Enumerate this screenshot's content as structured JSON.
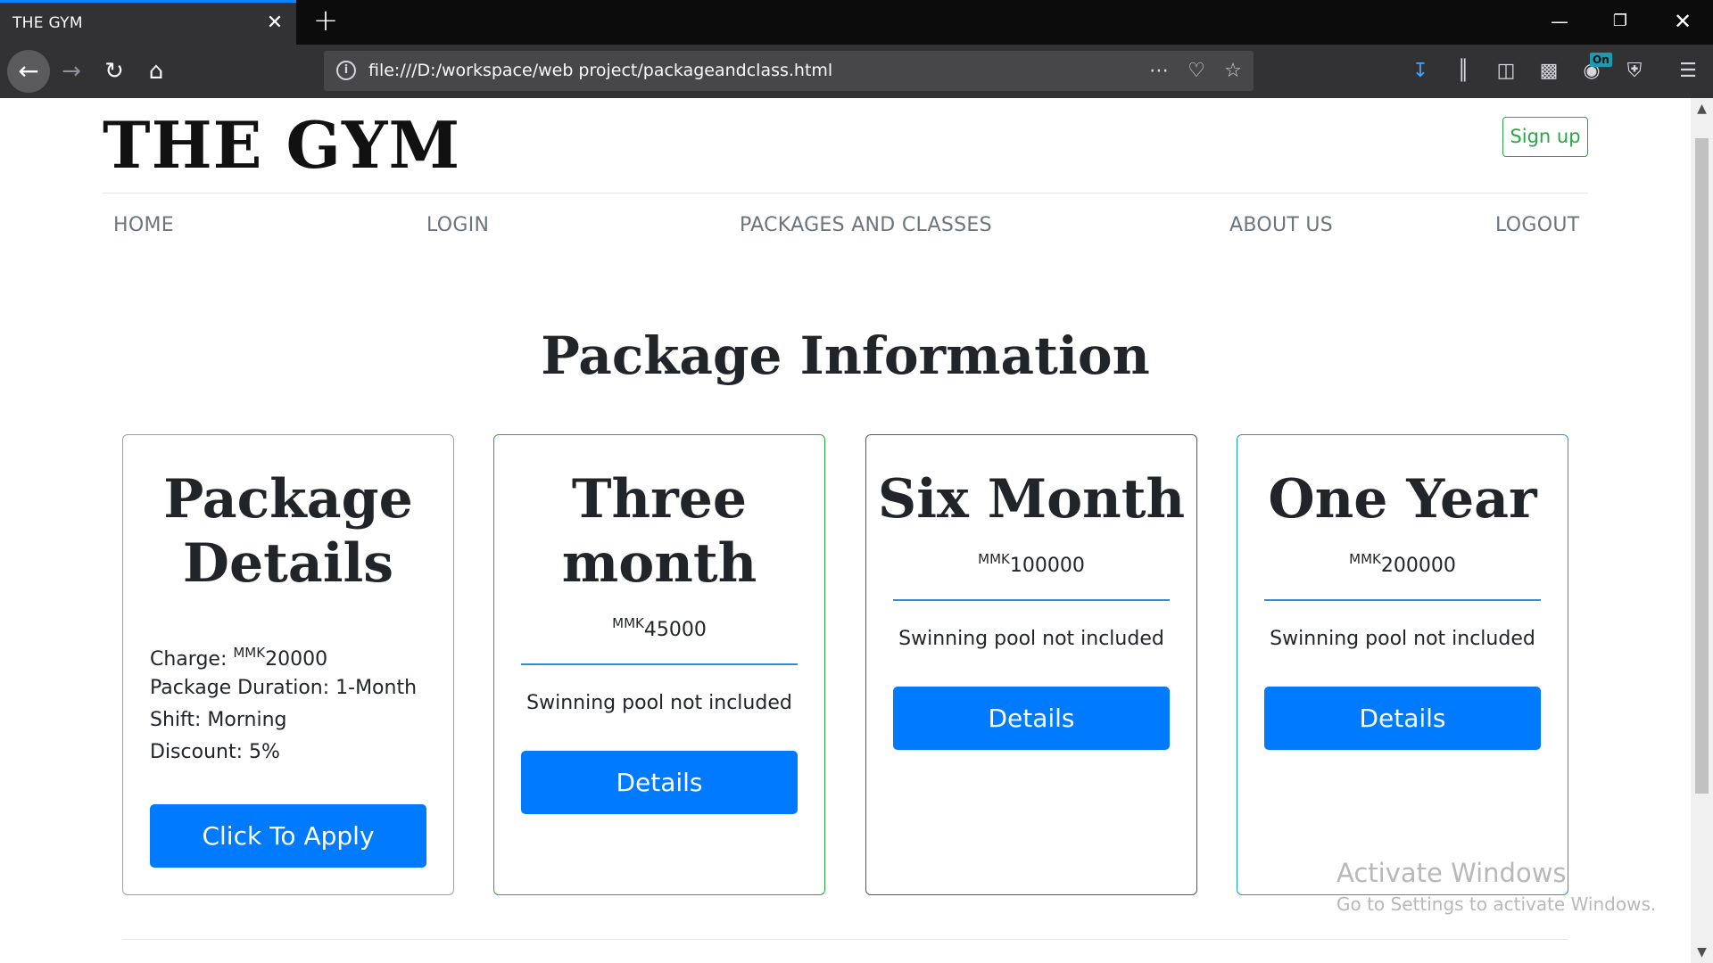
{
  "browser": {
    "tab_title": "THE GYM",
    "url": "file:///D:/workspace/web project/packageandclass.html",
    "extension_badge": "On"
  },
  "page": {
    "brand": "THE GYM",
    "signup_label": "Sign up",
    "nav": [
      {
        "label": "HOME"
      },
      {
        "label": "LOGIN"
      },
      {
        "label": "PACKAGES AND CLASSES"
      },
      {
        "label": "ABOUT US"
      },
      {
        "label": "LOGOUT"
      }
    ],
    "section_title": "Package Information",
    "cards": [
      {
        "title_line1": "Package",
        "title_line2": "Details",
        "charge_label": "Charge:",
        "currency": "MMK",
        "charge_value": "20000",
        "duration": "Package Duration: 1-Month",
        "shift": "Shift: Morning",
        "discount": "Discount: 5%",
        "button": "Click To Apply",
        "border_color": "#9e9e9e"
      },
      {
        "title_line1": "Three",
        "title_line2": "month",
        "currency": "MMK",
        "price": "45000",
        "note": "Swinning pool not included",
        "button": "Details",
        "border_color": "#28a745"
      },
      {
        "title_line1": "Six Month",
        "currency": "MMK",
        "price": "100000",
        "note": "Swinning pool not included",
        "button": "Details",
        "border_color": "#5a5a5a"
      },
      {
        "title_line1": "One Year",
        "currency": "MMK",
        "price": "200000",
        "note": "Swinning pool not included",
        "button": "Details",
        "border_color": "#17a2b8"
      }
    ]
  },
  "watermark": {
    "line1": "Activate Windows",
    "line2": "Go to Settings to activate Windows."
  },
  "colors": {
    "primary_button": "#007bff",
    "signup_green": "#28a745",
    "tab_accent": "#0a84ff",
    "chrome_dark": "#0c0c0d",
    "toolbar": "#323234"
  }
}
